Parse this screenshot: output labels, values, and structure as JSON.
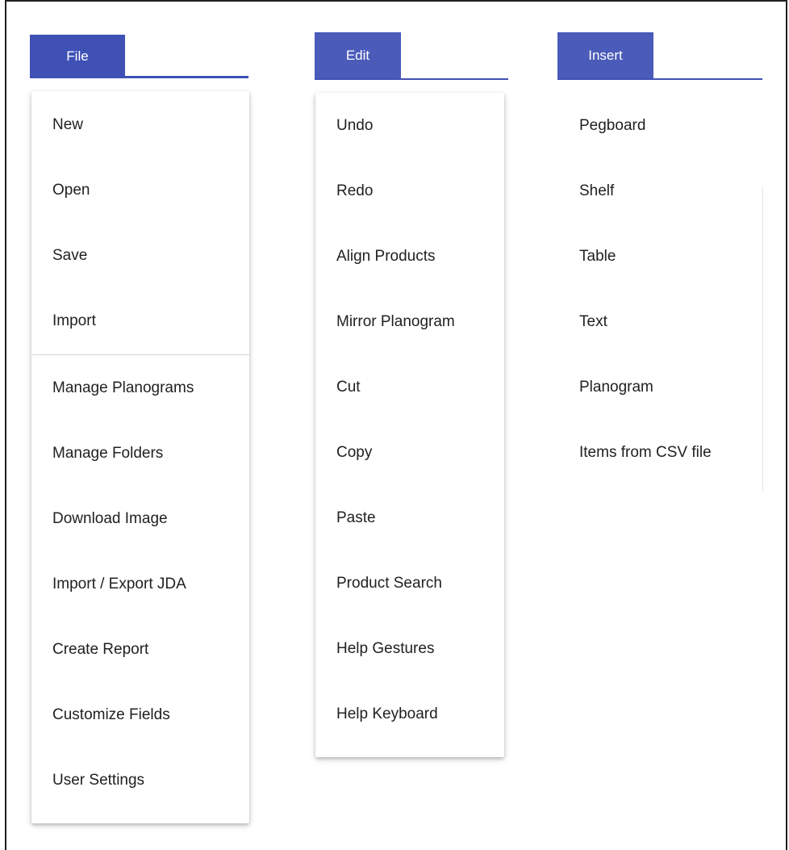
{
  "menus": {
    "file": {
      "tab_label": "File",
      "items_group1": [
        "New",
        "Open",
        "Save",
        "Import"
      ],
      "items_group2": [
        "Manage Planograms",
        "Manage Folders",
        "Download Image",
        "Import / Export JDA",
        "Create Report",
        "Customize Fields",
        "User Settings"
      ]
    },
    "edit": {
      "tab_label": "Edit",
      "items": [
        "Undo",
        "Redo",
        "Align Products",
        "Mirror Planogram",
        "Cut",
        "Copy",
        "Paste",
        "Product Search",
        "Help Gestures",
        "Help Keyboard"
      ]
    },
    "insert": {
      "tab_label": "Insert",
      "items": [
        "Pegboard",
        "Shelf",
        "Table",
        "Text",
        "Planogram",
        "Items from CSV file"
      ]
    }
  },
  "colors": {
    "accent": "#3f51b5",
    "text": "#212121",
    "divider": "#d6d6d6"
  }
}
